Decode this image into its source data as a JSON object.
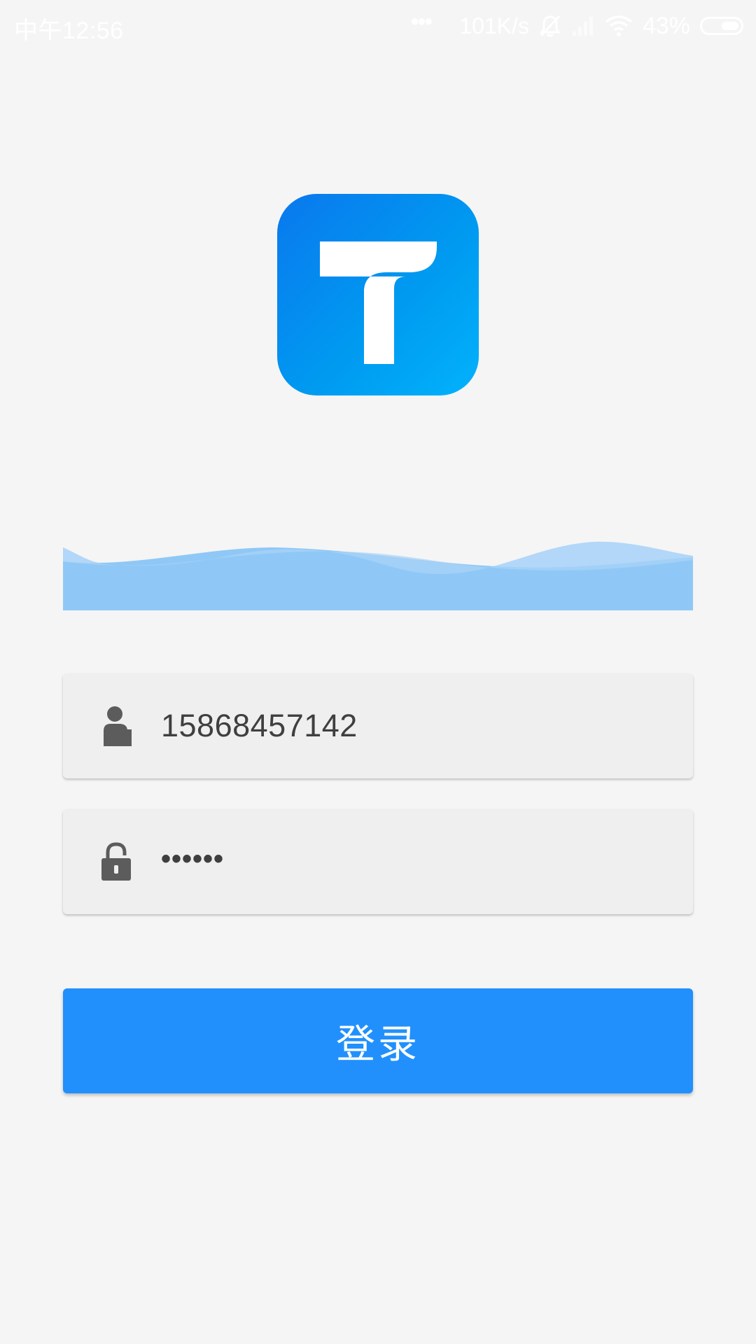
{
  "status_bar": {
    "time": "中午12:56",
    "dots": "•••",
    "network_speed": "101K/s",
    "battery_percent": "43%",
    "icons": [
      "mute-icon",
      "signal-icon",
      "wifi-icon",
      "battery-icon"
    ]
  },
  "logo": {
    "icon": "app-logo-t",
    "gradient_colors": [
      "#0a78ee",
      "#02b2fb"
    ]
  },
  "login_form": {
    "username": {
      "icon": "user-icon",
      "value": "15868457142"
    },
    "password": {
      "icon": "lock-icon",
      "value": "••••••"
    },
    "submit_label": "登录"
  },
  "colors": {
    "background": "#f5f5f5",
    "primary": "#2190fc",
    "field_background": "#efefef",
    "wave": "#8fc8f6"
  }
}
